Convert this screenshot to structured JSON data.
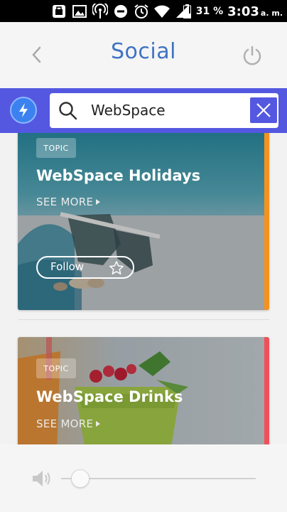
{
  "status_bar": {
    "battery_percent": "31 %",
    "time": "3:03",
    "ampm": "a. m."
  },
  "header": {
    "title": "Social",
    "back_icon": "chevron-left-icon",
    "power_icon": "power-icon"
  },
  "search": {
    "value": "WebSpace",
    "bolt_icon": "lightning-bolt-icon",
    "clear_icon": "close-icon"
  },
  "cards": [
    {
      "badge": "TOPIC",
      "title": "WebSpace Holidays",
      "see_more": "SEE MORE",
      "follow_label": "Follow",
      "accent_color": "#f5921e"
    },
    {
      "badge": "TOPIC",
      "title": "WebSpace Drinks",
      "see_more": "SEE MORE",
      "accent_color": "#f0505a"
    }
  ],
  "volume": {
    "icon": "speaker-icon",
    "level": 0.1
  },
  "colors": {
    "accent_blue": "#3f73c4",
    "search_bar": "#5458e0"
  }
}
